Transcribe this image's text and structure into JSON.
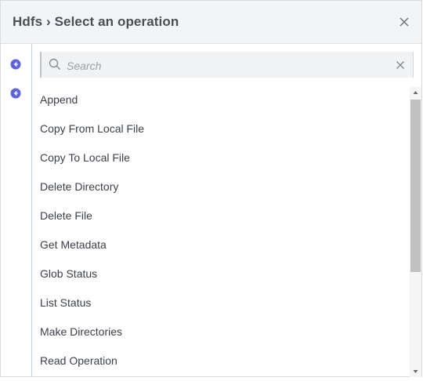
{
  "dialog": {
    "title": "Hdfs › Select an operation",
    "close_icon": "close-icon"
  },
  "left_rail": {
    "icons": [
      "operation-bullet-icon",
      "operation-bullet-icon"
    ],
    "accent_color": "#6069e6"
  },
  "search": {
    "placeholder": "Search",
    "value": "",
    "search_icon": "search-icon",
    "clear_icon": "clear-icon"
  },
  "operations": [
    {
      "label": "Append"
    },
    {
      "label": "Copy From Local File"
    },
    {
      "label": "Copy To Local File"
    },
    {
      "label": "Delete Directory"
    },
    {
      "label": "Delete File"
    },
    {
      "label": "Get Metadata"
    },
    {
      "label": "Glob Status"
    },
    {
      "label": "List Status"
    },
    {
      "label": "Make Directories"
    },
    {
      "label": "Read Operation"
    }
  ],
  "scrollbar": {
    "scroll_position_fraction": 0,
    "visible_fraction": 0.65
  }
}
